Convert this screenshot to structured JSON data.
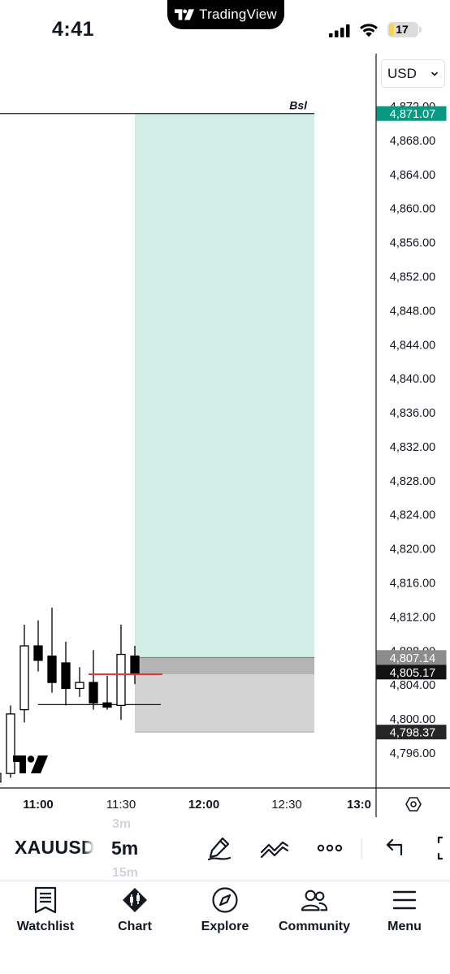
{
  "status_bar": {
    "time": "4:41",
    "app_name": "TradingView",
    "battery_level": "17",
    "battery_fraction": 0.17
  },
  "chart": {
    "currency": "USD",
    "drawing_label": "Bsl",
    "current_price": "4,805.17",
    "price_badges": {
      "target": "4,871.07",
      "entry": "4,807.14",
      "current": "4,805.17",
      "stop": "4,798.37"
    },
    "colors": {
      "target_zone": "#d1ede6",
      "stop_zone": "#d3d3d3",
      "entry_band": "#b4b4b4",
      "target_badge": "#089981",
      "entry_badge": "#8c8c8c",
      "current_badge": "#131313",
      "stop_badge": "#262626",
      "price_line": "#e53935"
    }
  },
  "chart_data": {
    "type": "candlestick",
    "x_tick_labels": [
      "11:00",
      "11:30",
      "12:00",
      "12:30",
      "13:0"
    ],
    "y_tick_labels": [
      "4,872.00",
      "4,868.00",
      "4,864.00",
      "4,860.00",
      "4,856.00",
      "4,852.00",
      "4,848.00",
      "4,844.00",
      "4,840.00",
      "4,836.00",
      "4,832.00",
      "4,828.00",
      "4,824.00",
      "4,820.00",
      "4,816.00",
      "4,812.00",
      "4,808.00",
      "4,804.00",
      "4,800.00",
      "4,796.00"
    ],
    "y_ticks": [
      4872,
      4868,
      4864,
      4860,
      4856,
      4852,
      4848,
      4844,
      4840,
      4836,
      4832,
      4828,
      4824,
      4820,
      4816,
      4812,
      4808,
      4804,
      4800,
      4796
    ],
    "ylim": [
      4793.6,
      4873.3
    ],
    "x_minutes_per_candle": 5,
    "first_candle_time": "10:45",
    "candles": [
      {
        "time": "10:45",
        "open": 4792.5,
        "high": 4796.5,
        "low": 4791.0,
        "close": 4793.5
      },
      {
        "time": "10:50",
        "open": 4793.5,
        "high": 4801.5,
        "low": 4793.0,
        "close": 4800.5
      },
      {
        "time": "10:55",
        "open": 4801.0,
        "high": 4811.0,
        "low": 4799.5,
        "close": 4808.5
      },
      {
        "time": "11:00",
        "open": 4808.5,
        "high": 4811.5,
        "low": 4805.5,
        "close": 4806.8
      },
      {
        "time": "11:05",
        "open": 4807.3,
        "high": 4813.0,
        "low": 4803.0,
        "close": 4804.2
      },
      {
        "time": "11:10",
        "open": 4806.5,
        "high": 4809.0,
        "low": 4801.5,
        "close": 4803.5
      },
      {
        "time": "11:15",
        "open": 4803.5,
        "high": 4806.0,
        "low": 4802.5,
        "close": 4804.2
      },
      {
        "time": "11:20",
        "open": 4804.2,
        "high": 4808.0,
        "low": 4801.0,
        "close": 4801.8
      },
      {
        "time": "11:25",
        "open": 4801.8,
        "high": 4805.0,
        "low": 4801.0,
        "close": 4801.3
      },
      {
        "time": "11:30",
        "open": 4801.5,
        "high": 4811.0,
        "low": 4799.8,
        "close": 4807.5
      },
      {
        "time": "11:35",
        "open": 4807.3,
        "high": 4808.5,
        "low": 4804.0,
        "close": 4805.3
      }
    ],
    "long_position": {
      "start_time": "11:35",
      "end_time": "12:40",
      "target": 4871.07,
      "entry": 4807.14,
      "stop": 4798.37
    },
    "horizontal_lines": [
      {
        "label": "Bsl",
        "price": 4871.07
      },
      {
        "label": "",
        "price": 4801.6
      }
    ],
    "current_price": 4805.17
  },
  "toolbar": {
    "symbol": "XAUUSD",
    "timeframe_prev": "3m",
    "timeframe": "5m",
    "timeframe_next": "15m"
  },
  "nav": {
    "items": [
      {
        "label": "Watchlist"
      },
      {
        "label": "Chart"
      },
      {
        "label": "Explore"
      },
      {
        "label": "Community"
      },
      {
        "label": "Menu"
      }
    ]
  }
}
